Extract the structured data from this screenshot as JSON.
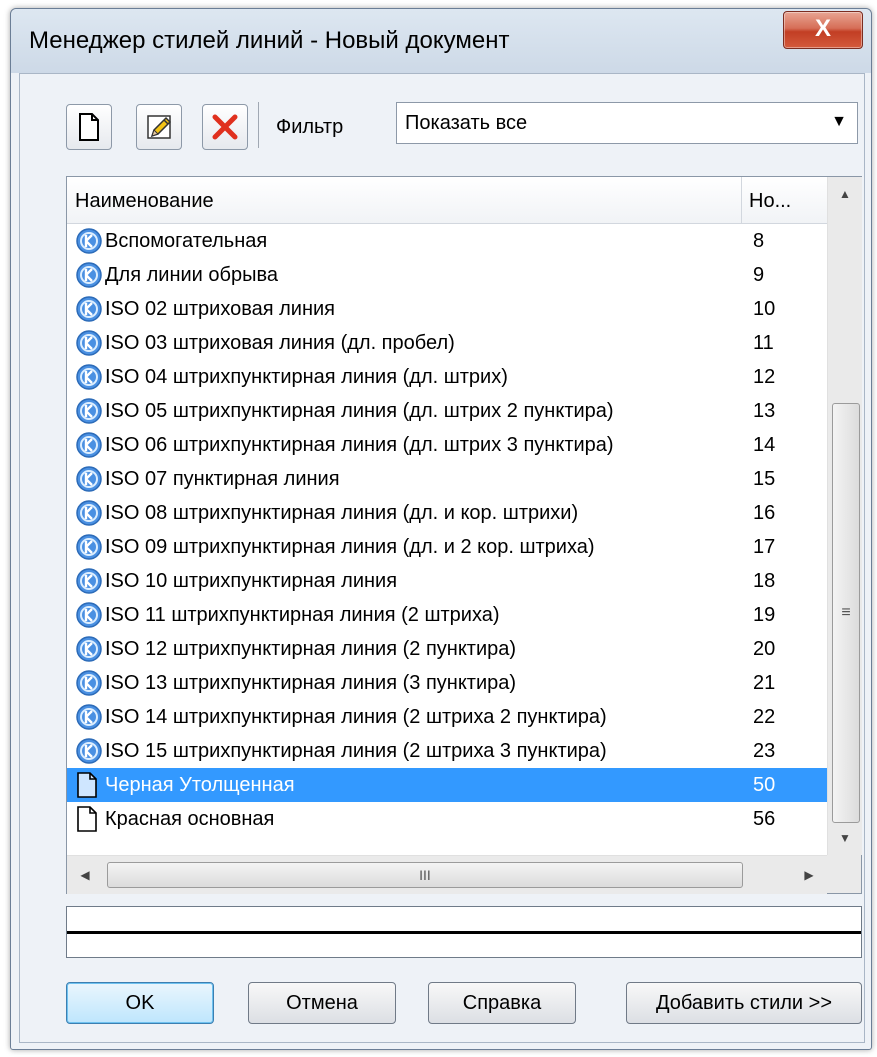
{
  "window": {
    "title": "Менеджер стилей линий - Новый документ",
    "close_label": "X"
  },
  "toolbar": {
    "filter_label": "Фильтр",
    "filter_value": "Показать все"
  },
  "list": {
    "columns": [
      "Наименование",
      "Но..."
    ],
    "rows": [
      {
        "name": "Вспомогательная",
        "num": "8",
        "icon": "kompas-style-icon"
      },
      {
        "name": "Для линии обрыва",
        "num": "9",
        "icon": "kompas-style-icon"
      },
      {
        "name": "ISO 02 штриховая линия",
        "num": "10",
        "icon": "kompas-style-icon"
      },
      {
        "name": "ISO 03 штриховая линия (дл. пробел)",
        "num": "11",
        "icon": "kompas-style-icon"
      },
      {
        "name": "ISO 04 штрихпунктирная линия (дл. штрих)",
        "num": "12",
        "icon": "kompas-style-icon"
      },
      {
        "name": "ISO 05 штрихпунктирная линия (дл. штрих 2 пунктира)",
        "num": "13",
        "icon": "kompas-style-icon"
      },
      {
        "name": "ISO 06 штрихпунктирная линия (дл. штрих 3 пунктира)",
        "num": "14",
        "icon": "kompas-style-icon"
      },
      {
        "name": "ISO 07 пунктирная линия",
        "num": "15",
        "icon": "kompas-style-icon"
      },
      {
        "name": "ISO 08 штрихпунктирная линия (дл. и кор. штрихи)",
        "num": "16",
        "icon": "kompas-style-icon"
      },
      {
        "name": "ISO 09 штрихпунктирная линия (дл. и 2 кор. штриха)",
        "num": "17",
        "icon": "kompas-style-icon"
      },
      {
        "name": "ISO 10 штрихпунктирная линия",
        "num": "18",
        "icon": "kompas-style-icon"
      },
      {
        "name": "ISO 11 штрихпунктирная линия (2 штриха)",
        "num": "19",
        "icon": "kompas-style-icon"
      },
      {
        "name": "ISO 12 штрихпунктирная линия (2 пунктира)",
        "num": "20",
        "icon": "kompas-style-icon"
      },
      {
        "name": "ISO 13 штрихпунктирная линия (3 пунктира)",
        "num": "21",
        "icon": "kompas-style-icon"
      },
      {
        "name": "ISO 14 штрихпунктирная линия (2 штриха 2 пунктира)",
        "num": "22",
        "icon": "kompas-style-icon"
      },
      {
        "name": "ISO 15 штрихпунктирная линия (2 штриха 3 пунктира)",
        "num": "23",
        "icon": "kompas-style-icon"
      },
      {
        "name": "Черная Утолщенная",
        "num": "50",
        "icon": "document-icon",
        "selected": true
      },
      {
        "name": "Красная основная",
        "num": "56",
        "icon": "document-icon"
      }
    ],
    "hscroll_grip": "III",
    "vscroll_grip": "≡"
  },
  "buttons": {
    "ok": "OK",
    "cancel": "Отмена",
    "help": "Справка",
    "add_styles": "Добавить стили >>"
  },
  "colors": {
    "selection": "#3399ff",
    "style_icon": "#4a90e2"
  }
}
